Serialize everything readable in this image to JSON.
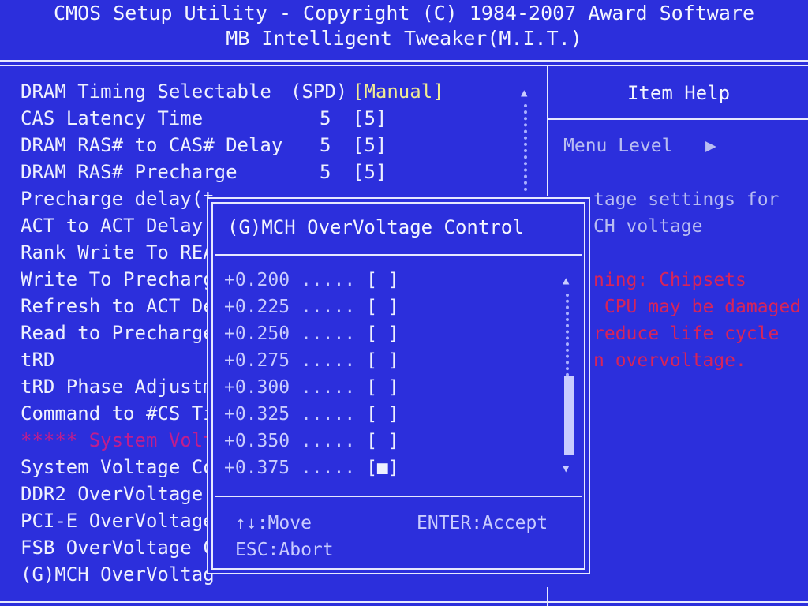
{
  "header": {
    "line1": "CMOS Setup Utility - Copyright (C) 1984-2007 Award Software",
    "line2": "MB Intelligent Tweaker(M.I.T.)"
  },
  "menu": {
    "spd_label": "(SPD)",
    "items": [
      {
        "label": "DRAM Timing Selectable",
        "spd": "",
        "value": "[Manual]"
      },
      {
        "label": "CAS Latency Time",
        "spd": "5",
        "value": "[5]"
      },
      {
        "label": "DRAM RAS# to CAS# Delay",
        "spd": "5",
        "value": "[5]"
      },
      {
        "label": "DRAM RAS# Precharge",
        "spd": "5",
        "value": "[5]"
      },
      {
        "label": "Precharge delay(t",
        "spd": "",
        "value": ""
      },
      {
        "label": "ACT to ACT Delay(",
        "spd": "",
        "value": ""
      },
      {
        "label": "Rank Write To REA",
        "spd": "",
        "value": ""
      },
      {
        "label": "Write To Precharg",
        "spd": "",
        "value": ""
      },
      {
        "label": "Refresh to ACT De",
        "spd": "",
        "value": ""
      },
      {
        "label": "Read to Precharge",
        "spd": "",
        "value": ""
      },
      {
        "label": "tRD",
        "spd": "",
        "value": ""
      },
      {
        "label": "tRD Phase Adjustm",
        "spd": "",
        "value": ""
      },
      {
        "label": "Command to #CS Ti",
        "spd": "",
        "value": ""
      },
      {
        "label": "***** System Volt",
        "spd": "",
        "value": ""
      },
      {
        "label": "System Voltage Co",
        "spd": "",
        "value": ""
      },
      {
        "label": "DDR2 OverVoltage",
        "spd": "",
        "value": ""
      },
      {
        "label": "PCI-E OverVoltage",
        "spd": "",
        "value": ""
      },
      {
        "label": "FSB OverVoltage C",
        "spd": "",
        "value": ""
      },
      {
        "label": "(G)MCH OverVoltag",
        "spd": "",
        "value": ""
      }
    ]
  },
  "help": {
    "title": "Item Help",
    "menu_level": "Menu Level   ▶",
    "lines_grey": [
      "tage settings for",
      "CH voltage"
    ],
    "lines_red": [
      "ning: Chipsets",
      " CPU may be damaged",
      "reduce life cycle",
      "n overvoltage."
    ]
  },
  "popup": {
    "title": "(G)MCH OverVoltage Control",
    "options": [
      {
        "value": "+0.200",
        "dots": ".....",
        "box": "[ ]"
      },
      {
        "value": "+0.225",
        "dots": ".....",
        "box": "[ ]"
      },
      {
        "value": "+0.250",
        "dots": ".....",
        "box": "[ ]"
      },
      {
        "value": "+0.275",
        "dots": ".....",
        "box": "[ ]"
      },
      {
        "value": "+0.300",
        "dots": ".....",
        "box": "[ ]"
      },
      {
        "value": "+0.325",
        "dots": ".....",
        "box": "[ ]"
      },
      {
        "value": "+0.350",
        "dots": ".....",
        "box": "[ ]"
      },
      {
        "value": "+0.375",
        "dots": ".....",
        "box": "[■]"
      }
    ],
    "selected_value": "+0.375",
    "help_move": "↑↓:Move",
    "help_accept": "ENTER:Accept",
    "help_abort": "ESC:Abort"
  },
  "colors": {
    "background": "#2c2fdc",
    "text": "#eef0ff",
    "highlight_value": "#f1ec92",
    "warning": "#d6245a",
    "section_header": "#c01d8e"
  },
  "icons": {
    "scroll_up": "triangle-up",
    "scroll_down": "triangle-down",
    "menu_level_arrow": "triangle-right"
  }
}
